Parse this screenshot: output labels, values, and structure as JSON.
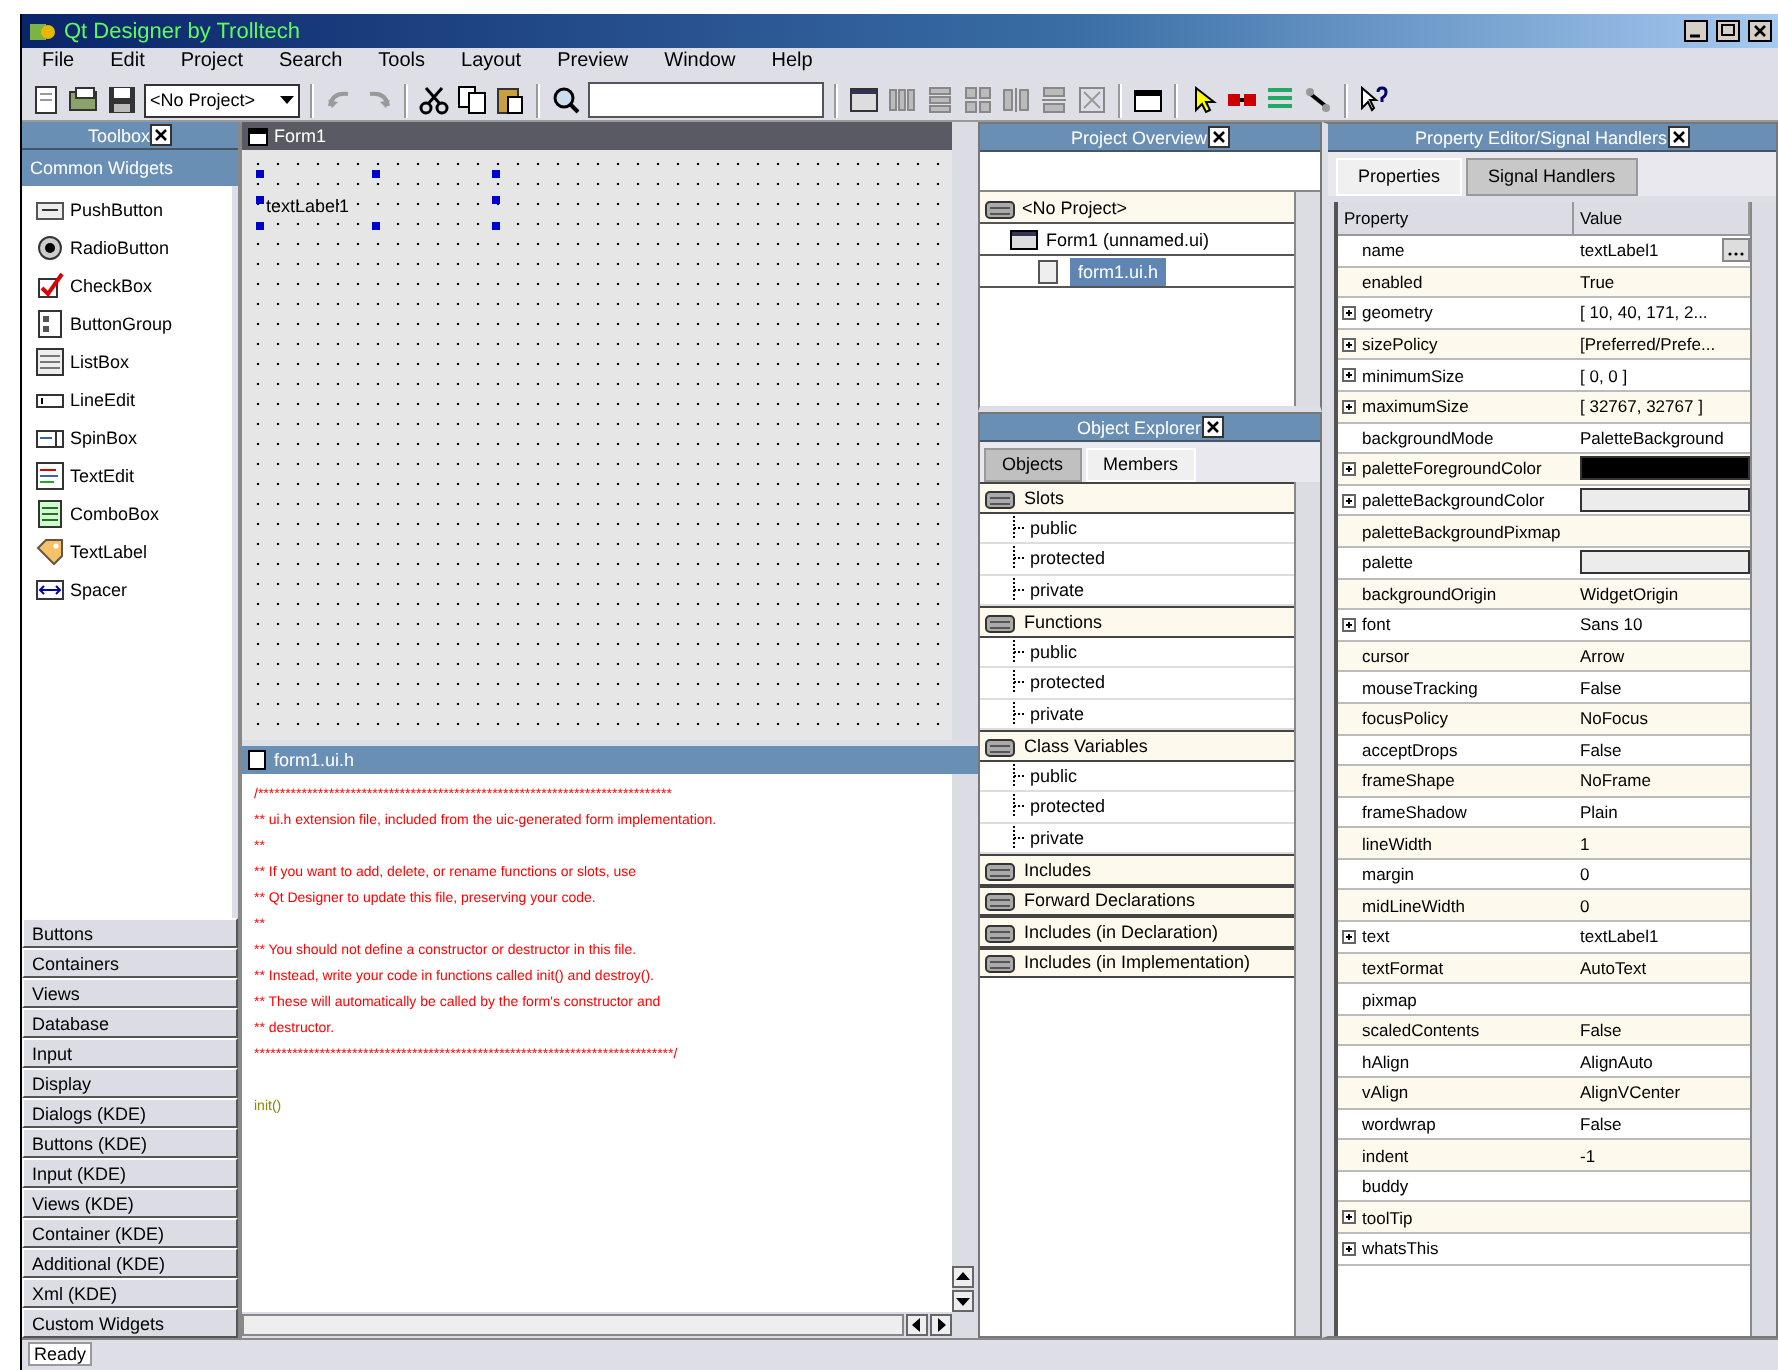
{
  "window": {
    "title": "Qt Designer by Trolltech"
  },
  "menu": [
    "File",
    "Edit",
    "Project",
    "Search",
    "Tools",
    "Layout",
    "Preview",
    "Window",
    "Help"
  ],
  "toolbar": {
    "project_combo": "<No Project>"
  },
  "toolbox": {
    "title": "Toolbox",
    "pages": [
      {
        "label": "Common Widgets",
        "selected": true,
        "items": [
          {
            "label": "PushButton",
            "kind": "pushbutton"
          },
          {
            "label": "RadioButton",
            "kind": "radiobutton"
          },
          {
            "label": "CheckBox",
            "kind": "checkbox"
          },
          {
            "label": "ButtonGroup",
            "kind": "buttongroup"
          },
          {
            "label": "ListBox",
            "kind": "listbox"
          },
          {
            "label": "LineEdit",
            "kind": "lineedit"
          },
          {
            "label": "SpinBox",
            "kind": "spinbox"
          },
          {
            "label": "TextEdit",
            "kind": "textedit"
          },
          {
            "label": "ComboBox",
            "kind": "combobox"
          },
          {
            "label": "TextLabel",
            "kind": "textlabel"
          },
          {
            "label": "Spacer",
            "kind": "spacer"
          }
        ]
      },
      {
        "label": "Buttons",
        "selected": false
      },
      {
        "label": "Containers",
        "selected": false
      },
      {
        "label": "Views",
        "selected": false
      },
      {
        "label": "Database",
        "selected": false
      },
      {
        "label": "Input",
        "selected": false
      },
      {
        "label": "Display",
        "selected": false
      },
      {
        "label": "Dialogs (KDE)",
        "selected": false
      },
      {
        "label": "Buttons (KDE)",
        "selected": false
      },
      {
        "label": "Input (KDE)",
        "selected": false
      },
      {
        "label": "Views (KDE)",
        "selected": false
      },
      {
        "label": "Container (KDE)",
        "selected": false
      },
      {
        "label": "Additional (KDE)",
        "selected": false
      },
      {
        "label": "Xml (KDE)",
        "selected": false
      },
      {
        "label": "Custom Widgets",
        "selected": false
      }
    ]
  },
  "form": {
    "title": "Form1",
    "label": "textLabel1"
  },
  "code_editor": {
    "title": "form1.ui.h",
    "lines": [
      {
        "text": "/****************************************************************************",
        "kind": "comment"
      },
      {
        "text": "** ui.h extension file, included from the uic-generated form implementation.",
        "kind": "comment"
      },
      {
        "text": "**",
        "kind": "comment"
      },
      {
        "text": "** If you want to add, delete, or rename functions or slots, use",
        "kind": "comment"
      },
      {
        "text": "** Qt Designer to update this file, preserving your code.",
        "kind": "comment"
      },
      {
        "text": "**",
        "kind": "comment"
      },
      {
        "text": "** You should not define a constructor or destructor in this file.",
        "kind": "comment"
      },
      {
        "text": "** Instead, write your code in functions called init() and destroy().",
        "kind": "comment"
      },
      {
        "text": "** These will automatically be called by the form's constructor and",
        "kind": "comment"
      },
      {
        "text": "** destructor.",
        "kind": "comment"
      },
      {
        "text": "*****************************************************************************/",
        "kind": "comment"
      },
      {
        "text": "init()",
        "kind": "code"
      }
    ]
  },
  "project_overview": {
    "title": "Project Overview",
    "tree": [
      {
        "label": "<No Project>",
        "selected": false,
        "children": [
          {
            "label": "Form1 (unnamed.ui)",
            "selected": false,
            "children": [
              {
                "label": "form1.ui.h",
                "selected": true
              }
            ]
          }
        ]
      }
    ]
  },
  "object_explorer": {
    "title": "Object Explorer",
    "tabs": [
      {
        "label": "Objects",
        "selected": false
      },
      {
        "label": "Members",
        "selected": true
      }
    ],
    "tree": [
      {
        "label": "Slots",
        "children": [
          {
            "label": "public"
          },
          {
            "label": "protected"
          },
          {
            "label": "private"
          }
        ]
      },
      {
        "label": "Functions",
        "children": [
          {
            "label": "public"
          },
          {
            "label": "protected"
          },
          {
            "label": "private"
          }
        ]
      },
      {
        "label": "Class Variables",
        "children": [
          {
            "label": "public"
          },
          {
            "label": "protected"
          },
          {
            "label": "private"
          }
        ]
      },
      {
        "label": "Includes"
      },
      {
        "label": "Forward Declarations"
      },
      {
        "label": "Includes (in Declaration)"
      },
      {
        "label": "Includes (in Implementation)"
      }
    ]
  },
  "property_editor": {
    "title": "Property Editor/Signal Handlers",
    "tabs": [
      {
        "label": "Properties",
        "selected": true
      },
      {
        "label": "Signal Handlers",
        "selected": false
      }
    ],
    "columns": [
      "Property",
      "Value"
    ],
    "rows": [
      {
        "name": "name",
        "value": "textLabel1",
        "kind": "edit"
      },
      {
        "name": "enabled",
        "value": "True",
        "kind": "text"
      },
      {
        "name": "geometry",
        "value": "[ 10, 40, 171, 2...",
        "kind": "text",
        "expanded": false
      },
      {
        "name": "sizePolicy",
        "value": "[Preferred/Prefe...",
        "kind": "text",
        "expanded": false
      },
      {
        "name": "minimumSize",
        "value": "[ 0, 0 ]",
        "kind": "text",
        "expanded": false
      },
      {
        "name": "maximumSize",
        "value": "[ 32767, 32767 ]",
        "kind": "text",
        "expanded": false
      },
      {
        "name": "backgroundMode",
        "value": "PaletteBackground",
        "kind": "text"
      },
      {
        "name": "paletteForegroundColor",
        "kind": "color",
        "color": "#000000",
        "expanded": false
      },
      {
        "name": "paletteBackgroundColor",
        "kind": "color",
        "color": "#ececec",
        "expanded": false
      },
      {
        "name": "paletteBackgroundPixmap",
        "kind": "text"
      },
      {
        "name": "palette",
        "kind": "color",
        "color": "#ececec"
      },
      {
        "name": "backgroundOrigin",
        "value": "WidgetOrigin",
        "kind": "text"
      },
      {
        "name": "font",
        "value": "Sans 10",
        "kind": "text",
        "expanded": false
      },
      {
        "name": "cursor",
        "value": "Arrow",
        "kind": "text"
      },
      {
        "name": "mouseTracking",
        "value": "False",
        "kind": "text"
      },
      {
        "name": "focusPolicy",
        "value": "NoFocus",
        "kind": "text"
      },
      {
        "name": "acceptDrops",
        "value": "False",
        "kind": "text"
      },
      {
        "name": "frameShape",
        "value": "NoFrame",
        "kind": "text"
      },
      {
        "name": "frameShadow",
        "value": "Plain",
        "kind": "text"
      },
      {
        "name": "lineWidth",
        "value": "1",
        "kind": "text"
      },
      {
        "name": "margin",
        "value": "0",
        "kind": "text"
      },
      {
        "name": "midLineWidth",
        "value": "0",
        "kind": "text"
      },
      {
        "name": "text",
        "value": "textLabel1",
        "kind": "text",
        "expanded": false
      },
      {
        "name": "textFormat",
        "value": "AutoText",
        "kind": "text"
      },
      {
        "name": "pixmap",
        "kind": "text"
      },
      {
        "name": "scaledContents",
        "value": "False",
        "kind": "text"
      },
      {
        "name": "hAlign",
        "value": "AlignAuto",
        "kind": "text"
      },
      {
        "name": "vAlign",
        "value": "AlignVCenter",
        "kind": "text"
      },
      {
        "name": "wordwrap",
        "value": "False",
        "kind": "text"
      },
      {
        "name": "indent",
        "value": "-1",
        "kind": "text"
      },
      {
        "name": "buddy",
        "kind": "text"
      },
      {
        "name": "toolTip",
        "kind": "text",
        "expanded": false
      },
      {
        "name": "whatsThis",
        "kind": "text",
        "expanded": false
      }
    ]
  },
  "status_bar": {
    "text": "Ready"
  }
}
